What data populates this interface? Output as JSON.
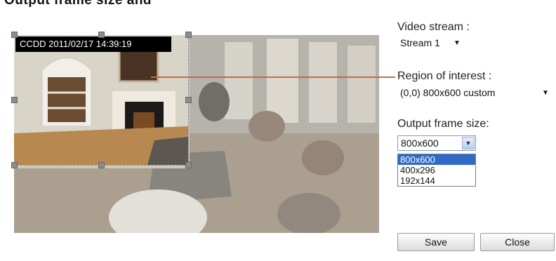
{
  "page": {
    "cut_title": "Output frame size and"
  },
  "camera": {
    "timestamp": "CCDD  2011/02/17 14:39:19"
  },
  "video_stream": {
    "label": "Video stream :",
    "value": "Stream 1",
    "arrow": "▼"
  },
  "roi": {
    "label": "Region of interest :",
    "value": "(0,0) 800x600 custom",
    "arrow": "▼"
  },
  "output_frame": {
    "label": "Output frame size:",
    "value": "800x600",
    "arrow": "▼",
    "options": [
      "800x600",
      "400x296",
      "192x144"
    ],
    "selected": "800x600"
  },
  "buttons": {
    "save": "Save",
    "close": "Close"
  },
  "colors": {
    "callout": "#c86a3c",
    "highlight": "#3169c6"
  }
}
